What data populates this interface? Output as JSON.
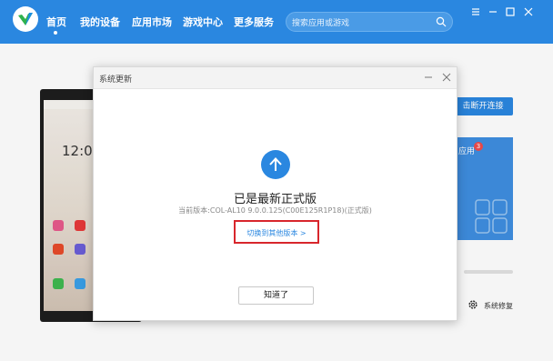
{
  "nav": {
    "items": [
      {
        "label": "首页"
      },
      {
        "label": "我的设备"
      },
      {
        "label": "应用市场"
      },
      {
        "label": "游戏中心"
      },
      {
        "label": "更多服务"
      }
    ],
    "search_placeholder": "搜索应用或游戏"
  },
  "background": {
    "phone_time": "12:0",
    "connect_button": "击断开连接",
    "app_card_label": "应用",
    "app_card_badge": "3",
    "repair_label": "系统修复"
  },
  "dialog": {
    "title": "系统更新",
    "status": "已是最新正式版",
    "version": "当前版本:COL-AL10 9.0.0.125(C00E125R1P18)(正式版)",
    "switch_link": "切换到其他版本 >",
    "ok_button": "知道了"
  },
  "colors": {
    "accent": "#2a87e0",
    "highlight_border": "#d8262c"
  }
}
